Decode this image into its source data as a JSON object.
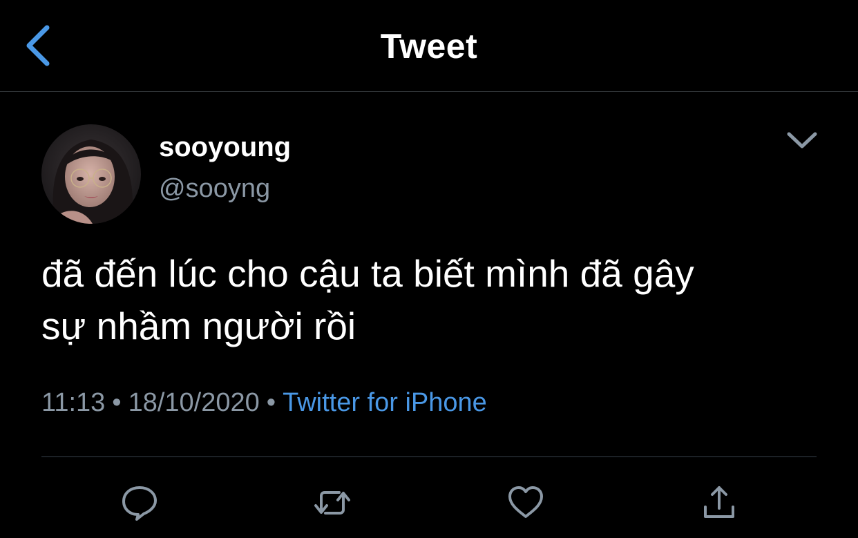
{
  "header": {
    "title": "Tweet",
    "back_icon": "chevron-left-icon"
  },
  "author": {
    "display_name": "sooyoung",
    "handle": "@sooyng",
    "avatar": "profile-photo"
  },
  "tweet": {
    "text_line1": "đã đến lúc cho cậu ta biết mình đã gây",
    "text_line2": "sự nhầm người rồi",
    "time": "11:13",
    "date": "18/10/2020",
    "separator": "•",
    "source": "Twitter for iPhone"
  },
  "actions": [
    {
      "name": "reply",
      "icon": "reply-icon"
    },
    {
      "name": "retweet",
      "icon": "retweet-icon"
    },
    {
      "name": "like",
      "icon": "heart-icon"
    },
    {
      "name": "share",
      "icon": "share-icon"
    }
  ],
  "colors": {
    "background": "#000000",
    "accent": "#4a98e6",
    "secondary_text": "#8b98a5",
    "divider": "#38444d"
  }
}
